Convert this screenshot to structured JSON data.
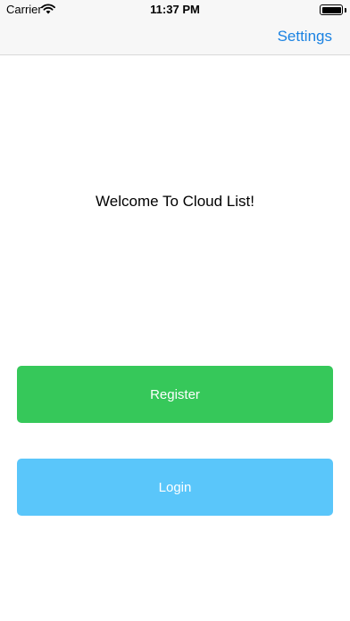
{
  "status_bar": {
    "carrier": "Carrier",
    "time": "11:37 PM",
    "wifi_icon": "wifi-icon",
    "battery_icon": "battery-icon"
  },
  "nav_bar": {
    "settings_label": "Settings"
  },
  "main": {
    "welcome_text": "Welcome To Cloud List!",
    "register_label": "Register",
    "login_label": "Login"
  },
  "colors": {
    "accent": "#1a82e2",
    "register_button": "#36c85a",
    "login_button": "#5ac6fa",
    "bar_background": "#f7f7f7"
  }
}
